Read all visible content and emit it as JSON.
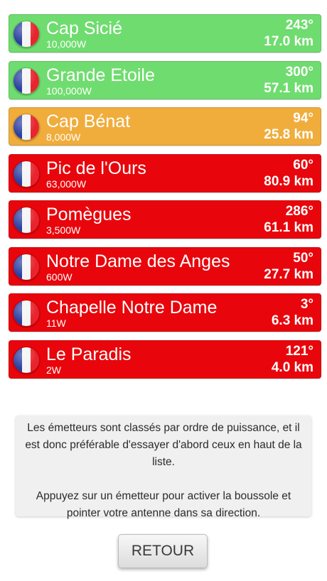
{
  "colors": {
    "strong": "#6fdc6f",
    "medium": "#f0ad3c",
    "weak": "#e8060c"
  },
  "transmitters": [
    {
      "name": "Cap Sicié",
      "power": "10,000W",
      "bearing": "243°",
      "distance": "17.0 km",
      "status": "strong",
      "flag": "france-flag-icon"
    },
    {
      "name": "Grande Etoile",
      "power": "100,000W",
      "bearing": "300°",
      "distance": "57.1 km",
      "status": "strong",
      "flag": "france-flag-icon"
    },
    {
      "name": "Cap Bénat",
      "power": "8,000W",
      "bearing": "94°",
      "distance": "25.8 km",
      "status": "medium",
      "flag": "france-flag-icon"
    },
    {
      "name": "Pic de l'Ours",
      "power": "63,000W",
      "bearing": "60°",
      "distance": "80.9 km",
      "status": "weak",
      "flag": "france-flag-icon"
    },
    {
      "name": "Pomègues",
      "power": "3,500W",
      "bearing": "286°",
      "distance": "61.1 km",
      "status": "weak",
      "flag": "france-flag-icon"
    },
    {
      "name": "Notre Dame des Anges",
      "power": "600W",
      "bearing": "50°",
      "distance": "27.7 km",
      "status": "weak",
      "flag": "france-flag-icon"
    },
    {
      "name": "Chapelle Notre Dame",
      "power": "11W",
      "bearing": "3°",
      "distance": "6.3 km",
      "status": "weak",
      "flag": "france-flag-icon"
    },
    {
      "name": "Le Paradis",
      "power": "2W",
      "bearing": "121°",
      "distance": "4.0 km",
      "status": "weak",
      "flag": "france-flag-icon"
    }
  ],
  "info": {
    "paragraph1": "Les émetteurs sont classés par ordre de puissance, et il est donc préférable d'essayer d'abord ceux en haut de la liste.",
    "paragraph2": "Appuyez sur un émetteur pour activer la boussole et pointer votre antenne dans sa direction."
  },
  "retour_label": "RETOUR"
}
